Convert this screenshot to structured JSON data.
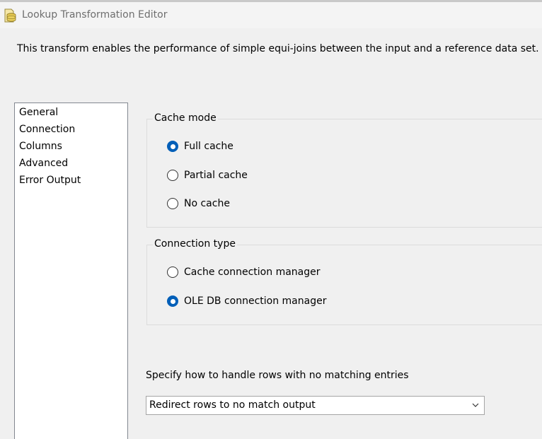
{
  "window": {
    "title": "Lookup Transformation Editor",
    "icon": "lookup-transformation-icon"
  },
  "description": "This transform enables the performance of simple equi-joins between the input and a reference data set.",
  "nav": {
    "items": [
      {
        "label": "General",
        "selected": true
      },
      {
        "label": "Connection",
        "selected": false
      },
      {
        "label": "Columns",
        "selected": false
      },
      {
        "label": "Advanced",
        "selected": false
      },
      {
        "label": "Error Output",
        "selected": false
      }
    ]
  },
  "cache_mode": {
    "legend": "Cache mode",
    "options": [
      {
        "label": "Full cache",
        "checked": true
      },
      {
        "label": "Partial cache",
        "checked": false
      },
      {
        "label": "No cache",
        "checked": false
      }
    ]
  },
  "connection_type": {
    "legend": "Connection type",
    "options": [
      {
        "label": "Cache connection manager",
        "checked": false
      },
      {
        "label": "OLE DB connection manager",
        "checked": true
      }
    ]
  },
  "no_match": {
    "label": "Specify how to handle rows with no matching entries",
    "selected": "Redirect rows to no match output",
    "chevron_icon": "chevron-down-icon"
  },
  "colors": {
    "accent": "#005fb8",
    "background": "#f0f0f0",
    "title_text": "#6e6e6e"
  }
}
